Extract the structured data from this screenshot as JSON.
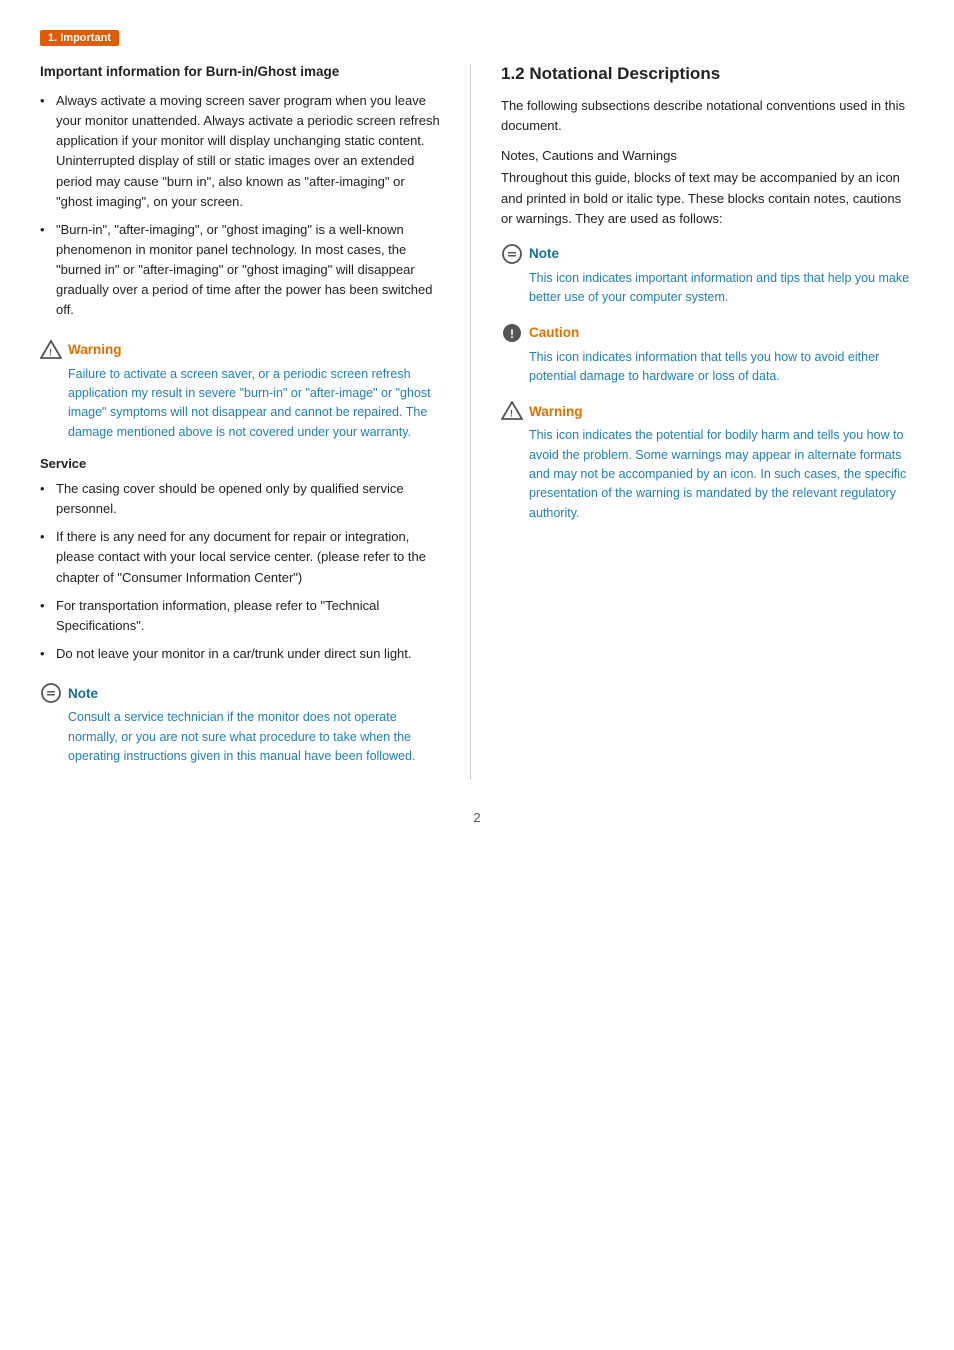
{
  "breadcrumb": {
    "label": "1. Important"
  },
  "left": {
    "burn_section": {
      "title": "Important information for Burn-in/Ghost image",
      "bullets": [
        "Always activate a moving screen saver program when you leave your monitor unattended. Always activate a periodic screen refresh application if your monitor will display unchanging static content. Uninterrupted display of still or static images over an extended period may cause \"burn in\", also known as \"after-imaging\" or \"ghost imaging\", on your screen.",
        "\"Burn-in\", \"after-imaging\", or \"ghost imaging\" is a well-known phenomenon in monitor panel technology. In most cases, the \"burned in\" or \"after-imaging\" or \"ghost imaging\" will disappear gradually over a period of time after the power has been switched off."
      ]
    },
    "burn_warning": {
      "title": "Warning",
      "body": "Failure to activate a screen saver, or a periodic screen refresh application my result in severe \"burn-in\" or \"after-image\" or \"ghost image\" symptoms will not disappear and cannot be repaired. The damage mentioned above is not covered under your warranty."
    },
    "service_section": {
      "title": "Service",
      "bullets": [
        "The casing cover should be opened only by qualified service personnel.",
        "If there is any need for any document for repair or integration, please contact with your local service center. (please refer to the chapter of \"Consumer Information Center\")",
        "For transportation information, please refer to \"Technical Specifications\".",
        "Do not leave your monitor in a car/trunk under direct sun light."
      ]
    },
    "service_note": {
      "title": "Note",
      "body": "Consult a service technician if the monitor does not operate normally, or you are not sure what procedure to take when the operating instructions given in this manual have been followed."
    }
  },
  "right": {
    "section_title": "1.2 Notational Descriptions",
    "intro_text": "The following subsections describe notational conventions used in this document.",
    "intro_text2": "Notes, Cautions and Warnings",
    "intro_text3": "Throughout this guide, blocks of text may be accompanied by an icon and printed in bold or italic type. These blocks contain notes, cautions or warnings. They are used as follows:",
    "note_block": {
      "title": "Note",
      "body": "This icon indicates important information and tips that help you make better use of your computer system."
    },
    "caution_block": {
      "title": "Caution",
      "body": "This icon indicates information that tells you how to avoid either potential damage to hardware or loss of data."
    },
    "warning_block": {
      "title": "Warning",
      "body": "This icon indicates the potential for bodily harm and tells you how to avoid the problem. Some warnings may appear in alternate formats and may not be accompanied by an icon. In such cases, the specific presentation of the warning is mandated by the relevant regulatory authority."
    }
  },
  "page_number": "2"
}
